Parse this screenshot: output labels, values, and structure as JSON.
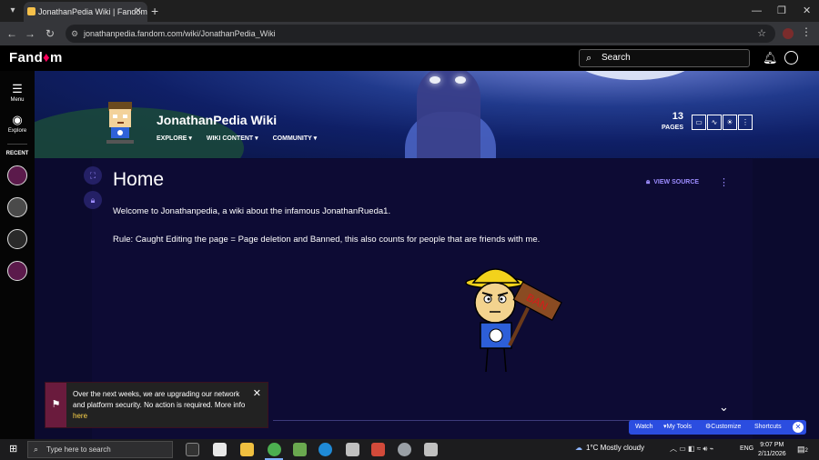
{
  "browser": {
    "tab_title": "JonathanPedia Wiki | Fandom",
    "tab_close": "✕",
    "new_tab": "+",
    "url": "jonathanpedia.fandom.com/wiki/JonathanPedia_Wiki"
  },
  "fandom": {
    "logo_prefix": "Fand",
    "logo_mark": "♦",
    "logo_suffix": "m",
    "search_label": "Search"
  },
  "rail": {
    "menu_label": "Menu",
    "explore_label": "Explore",
    "recent_label": "RECENT"
  },
  "wiki": {
    "title": "JonathanPedia Wiki",
    "nav": [
      {
        "label": "EXPLORE ▾"
      },
      {
        "label": "WIKI CONTENT ▾"
      },
      {
        "label": "COMMUNITY ▾"
      }
    ],
    "pages_count": "13",
    "pages_label": "PAGES"
  },
  "page": {
    "title": "Home",
    "view_source": "VIEW SOURCE",
    "paragraph1": "Welcome to Jonathanpedia, a wiki about the infamous JonathanRueda1.",
    "paragraph2": "Rule: Caught Editing the page = Page deletion and Banned, this also counts for people that are friends with me.",
    "sign_text": "BAN"
  },
  "notice": {
    "text": "Over the next weeks, we are upgrading our network and platform security. No action is required. More info ",
    "link": "here"
  },
  "toolbar": {
    "watch": "Watch",
    "my_tools": "My Tools",
    "customize": "Customize",
    "shortcuts": "Shortcuts"
  },
  "taskbar": {
    "search_placeholder": "Type here to search",
    "weather": "1°C  Mostly cloudy",
    "lang": "ENG",
    "time": "9:07 PM",
    "date": "2/11/2026",
    "notifications": "2"
  },
  "colors": {
    "fandom_accent": "#fa005a",
    "link_purple": "#9c8cff",
    "notice_bar": "#6a1b3d",
    "toolbar_blue": "#2b4de0"
  }
}
